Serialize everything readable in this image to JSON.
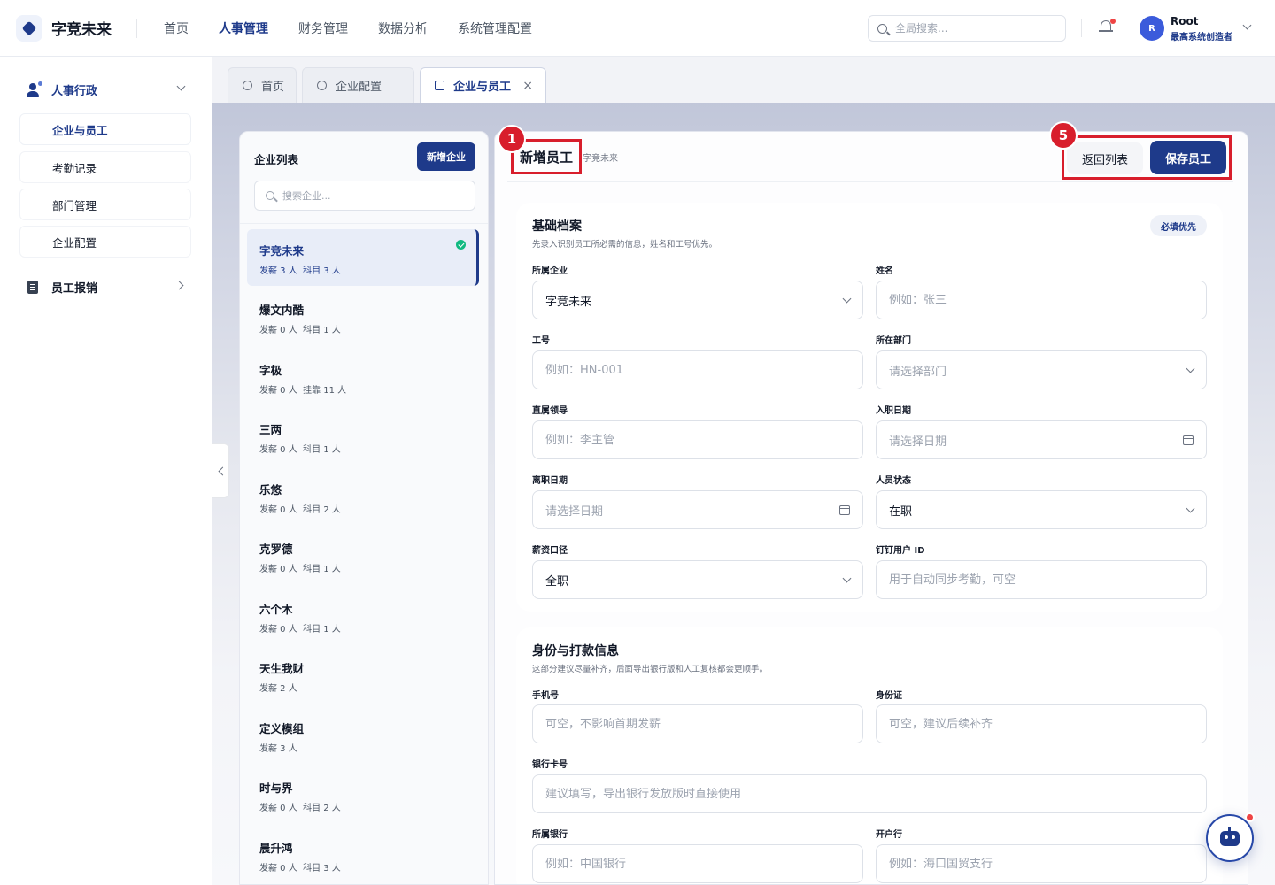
{
  "app": {
    "logo_text": "字竞未来",
    "nav": [
      "首页",
      "人事管理",
      "财务管理",
      "数据分析",
      "系统管理配置"
    ],
    "active_nav": "人事管理",
    "search_placeholder": "全局搜索...",
    "user": {
      "avatar": "R",
      "name": "Root",
      "role": "最高系统创造者"
    }
  },
  "sidebar": {
    "group1": {
      "label": "人事行政",
      "icon": "user-group-icon"
    },
    "items": [
      "企业与员工",
      "考勤记录",
      "部门管理",
      "企业配置"
    ],
    "active_item": "企业与员工",
    "group2": {
      "label": "员工报销",
      "icon": "document-icon"
    }
  },
  "tabs": [
    {
      "label": "首页",
      "icon": "pie-chart-icon"
    },
    {
      "label": "企业配置",
      "icon": "settings-icon"
    },
    {
      "label": "企业与员工",
      "icon": "building-icon",
      "closable": true,
      "close": "×"
    }
  ],
  "company_list": {
    "title": "企业列表",
    "add_button": "新增企业",
    "search_placeholder": "搜索企业...",
    "items": [
      {
        "name": "字竞未来",
        "meta": "发薪 3 人  科目 3 人",
        "active": true
      },
      {
        "name": "爆文内酷",
        "meta": "发薪 0 人  科目 1 人"
      },
      {
        "name": "字极",
        "meta": "发薪 0 人  挂靠 11 人"
      },
      {
        "name": "三两",
        "meta": "发薪 0 人  科目 1 人"
      },
      {
        "name": "乐悠",
        "meta": "发薪 0 人  科目 2 人"
      },
      {
        "name": "克罗德",
        "meta": "发薪 0 人  科目 1 人"
      },
      {
        "name": "六个木",
        "meta": "发薪 0 人  科目 1 人"
      },
      {
        "name": "天生我财",
        "meta": "发薪 2 人"
      },
      {
        "name": "定义模组",
        "meta": "发薪 3 人"
      },
      {
        "name": "时与界",
        "meta": "发薪 0 人  科目 2 人"
      },
      {
        "name": "晨升鸿",
        "meta": "发薪 0 人  科目 3 人"
      }
    ]
  },
  "form": {
    "title": "新增员工",
    "subtitle": "字竞未来",
    "badge_title": "1",
    "badge_actions": "5",
    "back_button": "返回列表",
    "save_button": "保存员工",
    "section1": {
      "title": "基础档案",
      "desc": "先录入识别员工所必需的信息，姓名和工号优先。",
      "tag": "必填优先",
      "fields": {
        "company": {
          "label": "所属企业",
          "value": "字竞未来"
        },
        "name": {
          "label": "姓名",
          "placeholder": "例如：张三"
        },
        "employee_no": {
          "label": "工号",
          "placeholder": "例如：HN-001"
        },
        "department": {
          "label": "所在部门",
          "placeholder": "请选择部门"
        },
        "leader": {
          "label": "直属领导",
          "placeholder": "例如：李主管"
        },
        "join_date": {
          "label": "入职日期",
          "placeholder": "请选择日期"
        },
        "leave_date": {
          "label": "离职日期",
          "placeholder": "请选择日期"
        },
        "status": {
          "label": "人员状态",
          "value": "在职"
        },
        "salary_type": {
          "label": "薪资口径",
          "value": "全职"
        },
        "dingtalk_id": {
          "label": "钉钉用户 ID",
          "placeholder": "用于自动同步考勤，可空"
        }
      }
    },
    "section2": {
      "title": "身份与打款信息",
      "desc": "这部分建议尽量补齐，后面导出银行版和人工复核都会更顺手。",
      "fields": {
        "phone": {
          "label": "手机号",
          "placeholder": "可空，不影响首期发薪"
        },
        "id_card": {
          "label": "身份证",
          "placeholder": "可空，建议后续补齐"
        },
        "bank_card": {
          "label": "银行卡号",
          "placeholder": "建议填写，导出银行发放版时直接使用"
        },
        "bank": {
          "label": "所属银行",
          "placeholder": "例如：中国银行"
        },
        "branch": {
          "label": "开户行",
          "placeholder": "例如：海口国贸支行"
        }
      }
    }
  },
  "colors": {
    "primary": "#1e3a8a",
    "highlight": "#d81e2c",
    "success": "#10b981"
  }
}
